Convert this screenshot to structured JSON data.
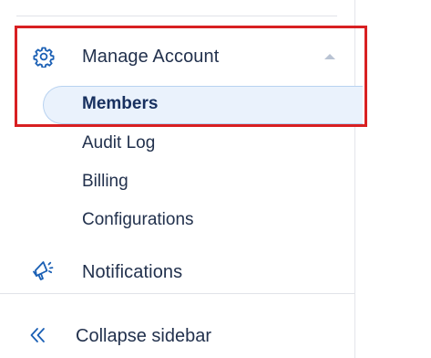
{
  "sidebar": {
    "manage_account": {
      "label": "Manage Account",
      "icon": "gear-icon",
      "expanded": true,
      "children": [
        {
          "label": "Members",
          "active": true
        },
        {
          "label": "Audit Log",
          "active": false
        },
        {
          "label": "Billing",
          "active": false
        },
        {
          "label": "Configurations",
          "active": false
        }
      ]
    },
    "notifications": {
      "label": "Notifications",
      "icon": "megaphone-icon"
    },
    "collapse": {
      "label": "Collapse sidebar",
      "icon": "double-chevron-left-icon"
    }
  },
  "colors": {
    "accent": "#1a5fb4",
    "text": "#22314d",
    "active_bg": "#eaf2fc",
    "active_border": "#b8d2f0",
    "highlight": "#d82022"
  }
}
